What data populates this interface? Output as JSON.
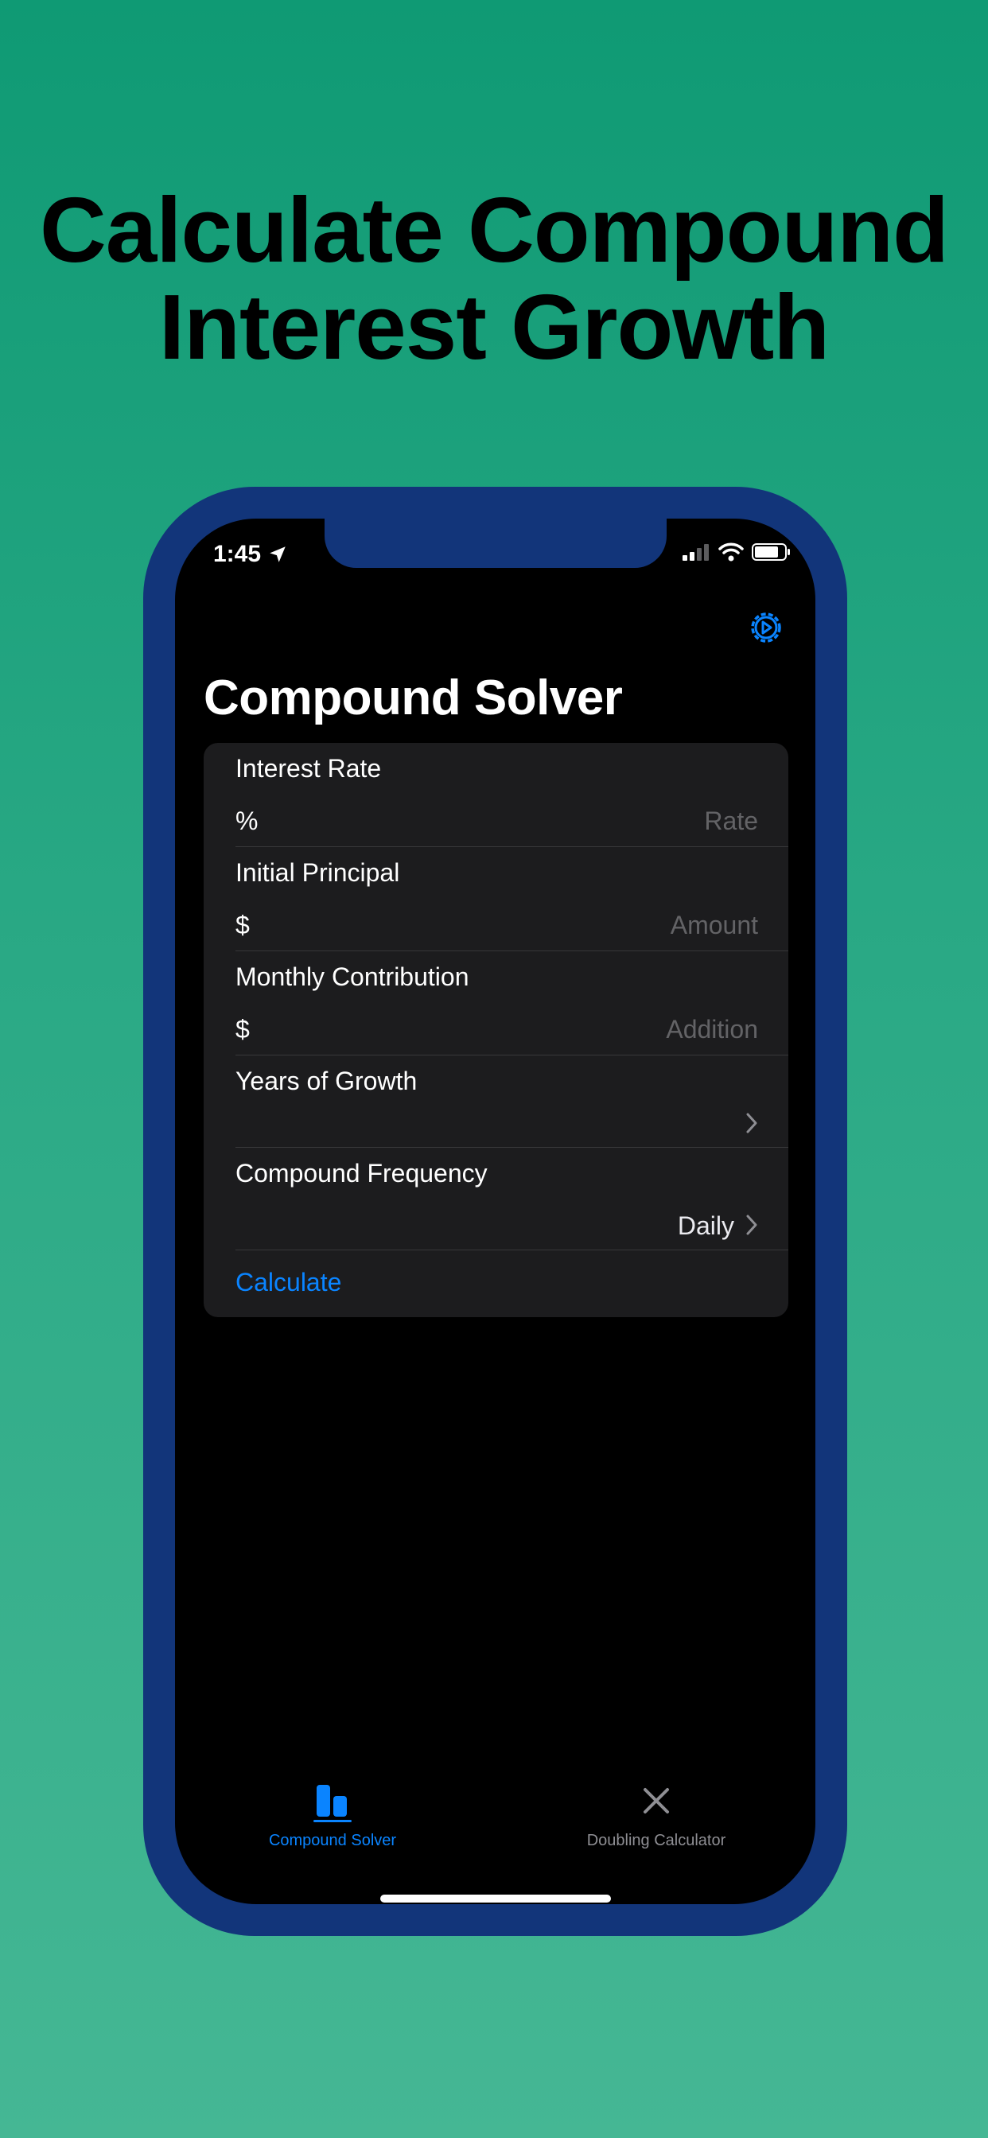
{
  "headline": {
    "line1": "Calculate Compound",
    "line2": "Interest Growth"
  },
  "status_bar": {
    "time": "1:45",
    "icons": [
      "location-arrow-icon",
      "signal-icon",
      "wifi-icon",
      "battery-icon"
    ]
  },
  "nav": {
    "title": "Compound Solver",
    "settings_icon": "gear-icon"
  },
  "form": {
    "interest_rate": {
      "label": "Interest Rate",
      "prefix": "%",
      "placeholder": "Rate"
    },
    "initial_principal": {
      "label": "Initial Principal",
      "prefix": "$",
      "placeholder": "Amount"
    },
    "monthly_contribution": {
      "label": "Monthly Contribution",
      "prefix": "$",
      "placeholder": "Addition"
    },
    "years_of_growth": {
      "label": "Years of Growth",
      "value": ""
    },
    "compound_frequency": {
      "label": "Compound Frequency",
      "value": "Daily"
    },
    "calculate_label": "Calculate"
  },
  "tabs": [
    {
      "label": "Compound Solver",
      "icon": "bar-chart-icon",
      "active": true
    },
    {
      "label": "Doubling Calculator",
      "icon": "multiply-icon",
      "active": false
    }
  ],
  "colors": {
    "accent": "#0a84ff",
    "frame": "#12357a",
    "background_top": "#0f9a74",
    "background_bottom": "#45b794"
  }
}
